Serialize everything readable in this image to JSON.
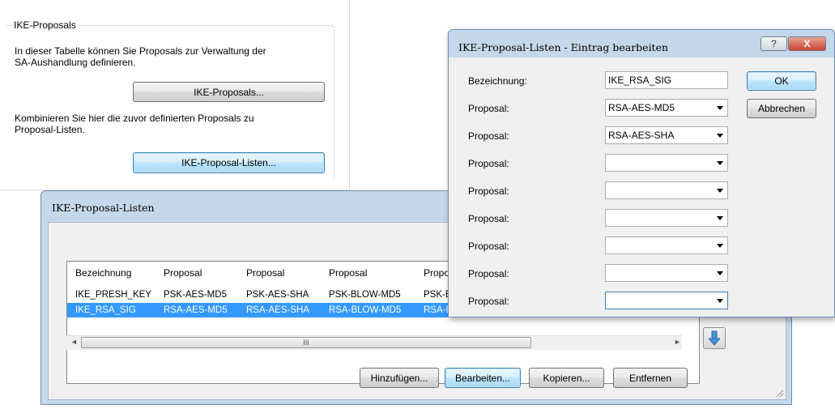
{
  "background": {
    "group_title": "IKE-Proposals",
    "desc1_line1": "In dieser Tabelle können Sie Proposals zur Verwaltung der",
    "desc1_line2": "SA-Aushandlung definieren.",
    "btn_proposals": "IKE-Proposals...",
    "desc2_line1": "Kombinieren Sie hier die zuvor definierten Proposals zu",
    "desc2_line2": "Proposal-Listen.",
    "btn_lists": "IKE-Proposal-Listen..."
  },
  "lists_window": {
    "title": "IKE-Proposal-Listen",
    "columns": [
      "Bezeichnung",
      "Proposal",
      "Proposal",
      "Proposal",
      "Propos"
    ],
    "rows": [
      [
        "IKE_PRESH_KEY",
        "PSK-AES-MD5",
        "PSK-AES-SHA",
        "PSK-BLOW-MD5",
        "PSK-BL"
      ],
      [
        "IKE_RSA_SIG",
        "RSA-AES-MD5",
        "RSA-AES-SHA",
        "RSA-BLOW-MD5",
        "RSA-BL"
      ]
    ],
    "selected_row": 1,
    "scroll_grip": "III",
    "buttons": {
      "add": "Hinzufügen...",
      "edit": "Bearbeiten...",
      "copy": "Kopieren...",
      "remove": "Entfernen"
    }
  },
  "edit_dialog": {
    "title": "IKE-Proposal-Listen - Eintrag bearbeiten",
    "help_glyph": "?",
    "close_glyph": "X",
    "name_label": "Bezeichnung:",
    "name_value": "IKE_RSA_SIG",
    "proposal_label": "Proposal:",
    "proposals": [
      "RSA-AES-MD5",
      "RSA-AES-SHA",
      "",
      "",
      "",
      "",
      "",
      ""
    ],
    "ok": "OK",
    "cancel": "Abbrechen"
  }
}
